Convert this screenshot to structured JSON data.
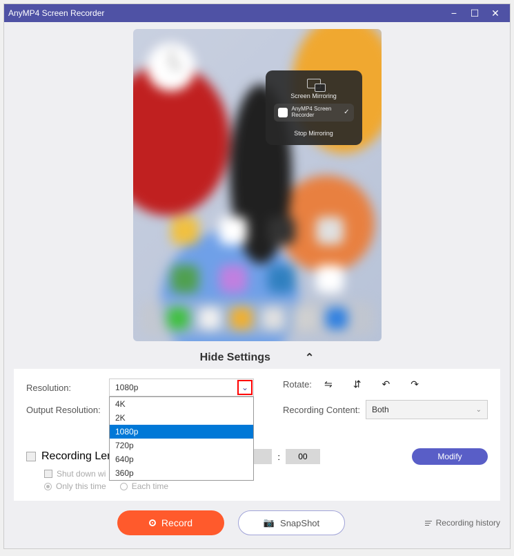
{
  "titlebar": {
    "title": "AnyMP4 Screen Recorder"
  },
  "mirror": {
    "header": "Screen Mirroring",
    "entry": "AnyMP4 Screen Recorder",
    "stop": "Stop Mirroring"
  },
  "hide_settings": "Hide Settings",
  "settings": {
    "resolution_label": "Resolution:",
    "resolution_value": "1080p",
    "resolution_options": [
      "4K",
      "2K",
      "1080p",
      "720p",
      "640p",
      "360p"
    ],
    "output_resolution_label": "Output Resolution:",
    "rotate_label": "Rotate:",
    "recording_content_label": "Recording Content:",
    "recording_content_value": "Both",
    "recording_length_label": "Recording Length",
    "time_a": "",
    "time_sep": ":",
    "time_b": "00",
    "modify": "Modify",
    "shutdown_label": "Shut down wi",
    "only_this_time": "Only this time",
    "each_time": "Each time"
  },
  "bottom": {
    "record": "Record",
    "snapshot": "SnapShot",
    "history": "Recording history"
  }
}
